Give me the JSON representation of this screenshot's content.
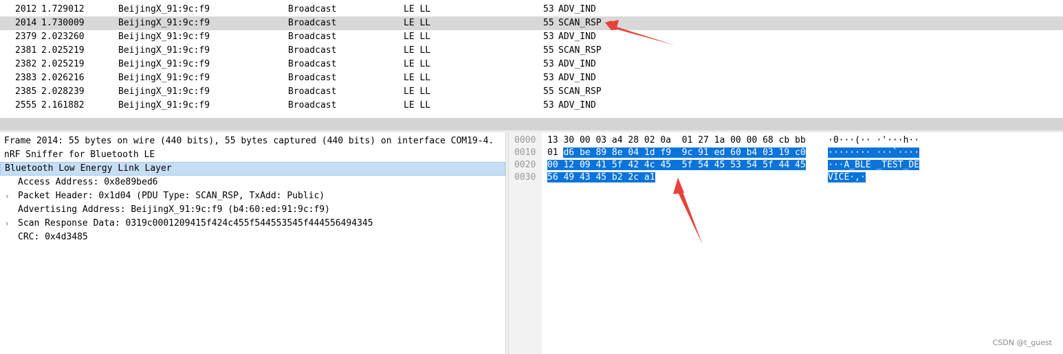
{
  "packets": [
    {
      "no": "2012",
      "time": "1.729012",
      "src": "BeijingX_91:9c:f9",
      "dst": "Broadcast",
      "proto": "LE LL",
      "len": "53",
      "info": "ADV_IND",
      "selected": false
    },
    {
      "no": "2014",
      "time": "1.730009",
      "src": "BeijingX_91:9c:f9",
      "dst": "Broadcast",
      "proto": "LE LL",
      "len": "55",
      "info": "SCAN_RSP",
      "selected": true
    },
    {
      "no": "2379",
      "time": "2.023260",
      "src": "BeijingX_91:9c:f9",
      "dst": "Broadcast",
      "proto": "LE LL",
      "len": "53",
      "info": "ADV_IND",
      "selected": false
    },
    {
      "no": "2381",
      "time": "2.025219",
      "src": "BeijingX_91:9c:f9",
      "dst": "Broadcast",
      "proto": "LE LL",
      "len": "55",
      "info": "SCAN_RSP",
      "selected": false
    },
    {
      "no": "2382",
      "time": "2.025219",
      "src": "BeijingX_91:9c:f9",
      "dst": "Broadcast",
      "proto": "LE LL",
      "len": "53",
      "info": "ADV_IND",
      "selected": false
    },
    {
      "no": "2383",
      "time": "2.026216",
      "src": "BeijingX_91:9c:f9",
      "dst": "Broadcast",
      "proto": "LE LL",
      "len": "53",
      "info": "ADV_IND",
      "selected": false
    },
    {
      "no": "2385",
      "time": "2.028239",
      "src": "BeijingX_91:9c:f9",
      "dst": "Broadcast",
      "proto": "LE LL",
      "len": "55",
      "info": "SCAN_RSP",
      "selected": false
    },
    {
      "no": "2555",
      "time": "2.161882",
      "src": "BeijingX_91:9c:f9",
      "dst": "Broadcast",
      "proto": "LE LL",
      "len": "53",
      "info": "ADV_IND",
      "selected": false
    }
  ],
  "details": [
    {
      "text": "Frame 2014: 55 bytes on wire (440 bits), 55 bytes captured (440 bits) on interface COM19-4.",
      "expandable": false,
      "highlight": false,
      "indent": false
    },
    {
      "text": "nRF Sniffer for Bluetooth LE",
      "expandable": false,
      "highlight": false,
      "indent": false
    },
    {
      "text": "Bluetooth Low Energy Link Layer",
      "expandable": false,
      "highlight": true,
      "indent": false
    },
    {
      "text": "Access Address: 0x8e89bed6",
      "expandable": false,
      "highlight": false,
      "indent": true
    },
    {
      "text": "Packet Header: 0x1d04 (PDU Type: SCAN_RSP, TxAdd: Public)",
      "expandable": true,
      "highlight": false,
      "indent": true
    },
    {
      "text": "Advertising Address: BeijingX_91:9c:f9 (b4:60:ed:91:9c:f9)",
      "expandable": false,
      "highlight": false,
      "indent": true
    },
    {
      "text": "Scan Response Data: 0319c0001209415f424c455f544553545f444556494345",
      "expandable": true,
      "highlight": false,
      "indent": true
    },
    {
      "text": "CRC: 0x4d3485",
      "expandable": false,
      "highlight": false,
      "indent": true
    }
  ],
  "bytes": [
    {
      "offset": "0000",
      "hex_plain": "13 30 00 03 a4 28 02 0a  01 27 1a 00 00 68 cb bb",
      "hex_sel": "",
      "ascii_plain": "·0···(·· ·'···h··",
      "ascii_sel": ""
    },
    {
      "offset": "0010",
      "hex_plain": "01 ",
      "hex_sel": "d6 be 89 8e 04 1d f9  9c 91 ed 60 b4 03 19 c0",
      "ascii_plain": "",
      "ascii_sel": "········ ···`····"
    },
    {
      "offset": "0020",
      "hex_plain": "",
      "hex_sel": "00 12 09 41 5f 42 4c 45  5f 54 45 53 54 5f 44 45",
      "ascii_plain": "",
      "ascii_sel": "···A_BLE _TEST_DE"
    },
    {
      "offset": "0030",
      "hex_plain": "",
      "hex_sel": "56 49 43 45 b2 2c a1",
      "ascii_plain": "",
      "ascii_sel": "VICE·,·"
    }
  ],
  "watermark": "CSDN @t_guest",
  "colors": {
    "selection_row": "#d8d8d8",
    "tree_highlight": "#c6def4",
    "byte_selection": "#0a74da",
    "arrow": "#e8413a"
  }
}
